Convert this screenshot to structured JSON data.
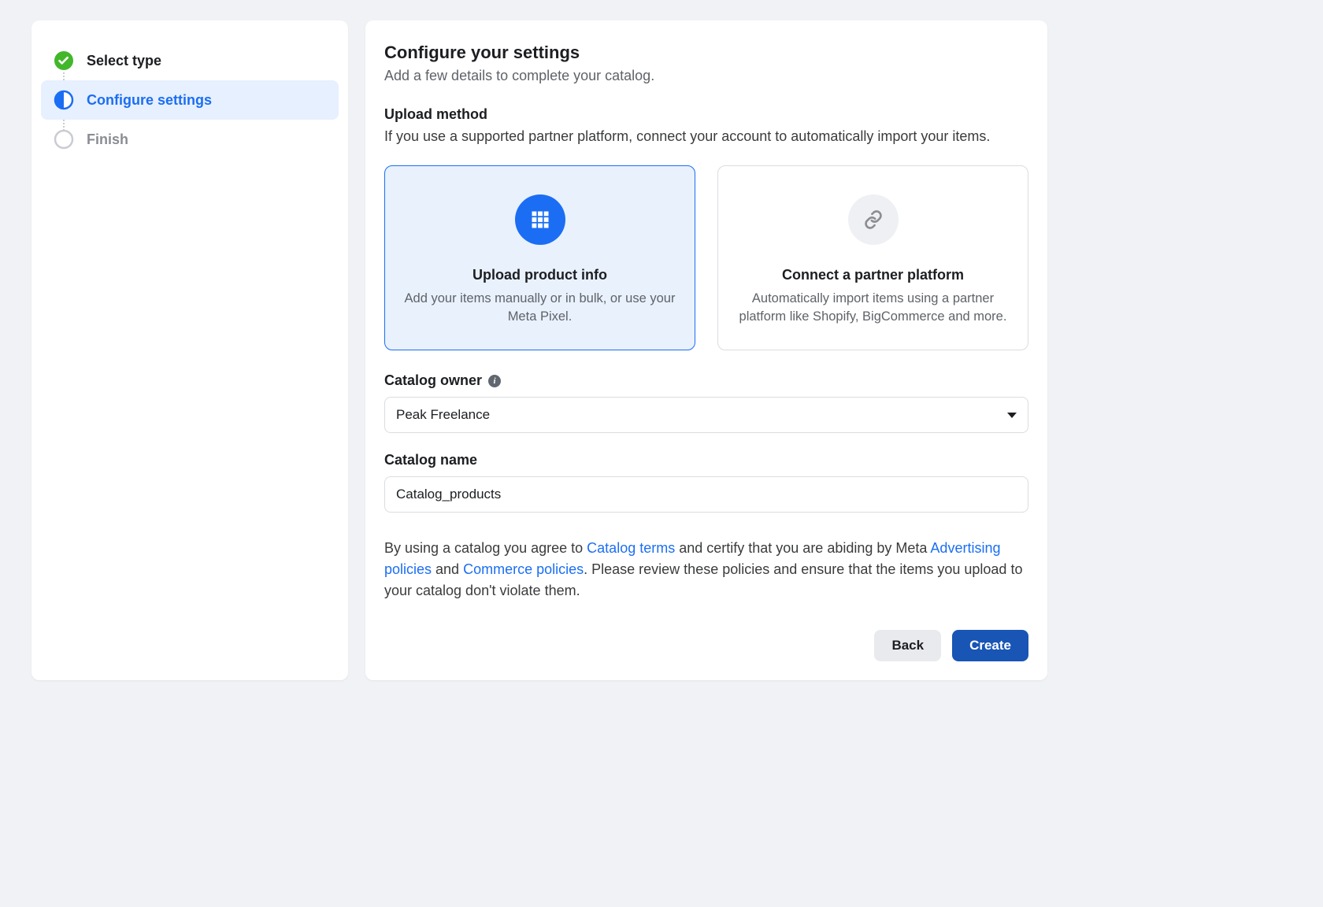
{
  "sidebar": {
    "steps": [
      {
        "label": "Select type",
        "state": "done"
      },
      {
        "label": "Configure settings",
        "state": "current"
      },
      {
        "label": "Finish",
        "state": "future"
      }
    ]
  },
  "header": {
    "title": "Configure your settings",
    "subtitle": "Add a few details to complete your catalog."
  },
  "upload_method": {
    "label": "Upload method",
    "help": "If you use a supported partner platform, connect your account to automatically import your items.",
    "options": [
      {
        "id": "upload",
        "icon": "grid-icon",
        "title": "Upload product info",
        "desc": "Add your items manually or in bulk, or use your Meta Pixel.",
        "selected": true
      },
      {
        "id": "partner",
        "icon": "link-icon",
        "title": "Connect a partner platform",
        "desc": "Automatically import items using a partner platform like Shopify, BigCommerce and more.",
        "selected": false
      }
    ]
  },
  "catalog_owner": {
    "label": "Catalog owner",
    "value": "Peak Freelance"
  },
  "catalog_name": {
    "label": "Catalog name",
    "value": "Catalog_products"
  },
  "legal": {
    "part1": "By using a catalog you agree to ",
    "link1": "Catalog terms",
    "part2": " and certify that you are abiding by Meta ",
    "link2": "Advertising policies",
    "part3": " and ",
    "link3": "Commerce policies",
    "part4": ". Please review these policies and ensure that the items you upload to your catalog don't violate them."
  },
  "actions": {
    "back": "Back",
    "create": "Create"
  }
}
